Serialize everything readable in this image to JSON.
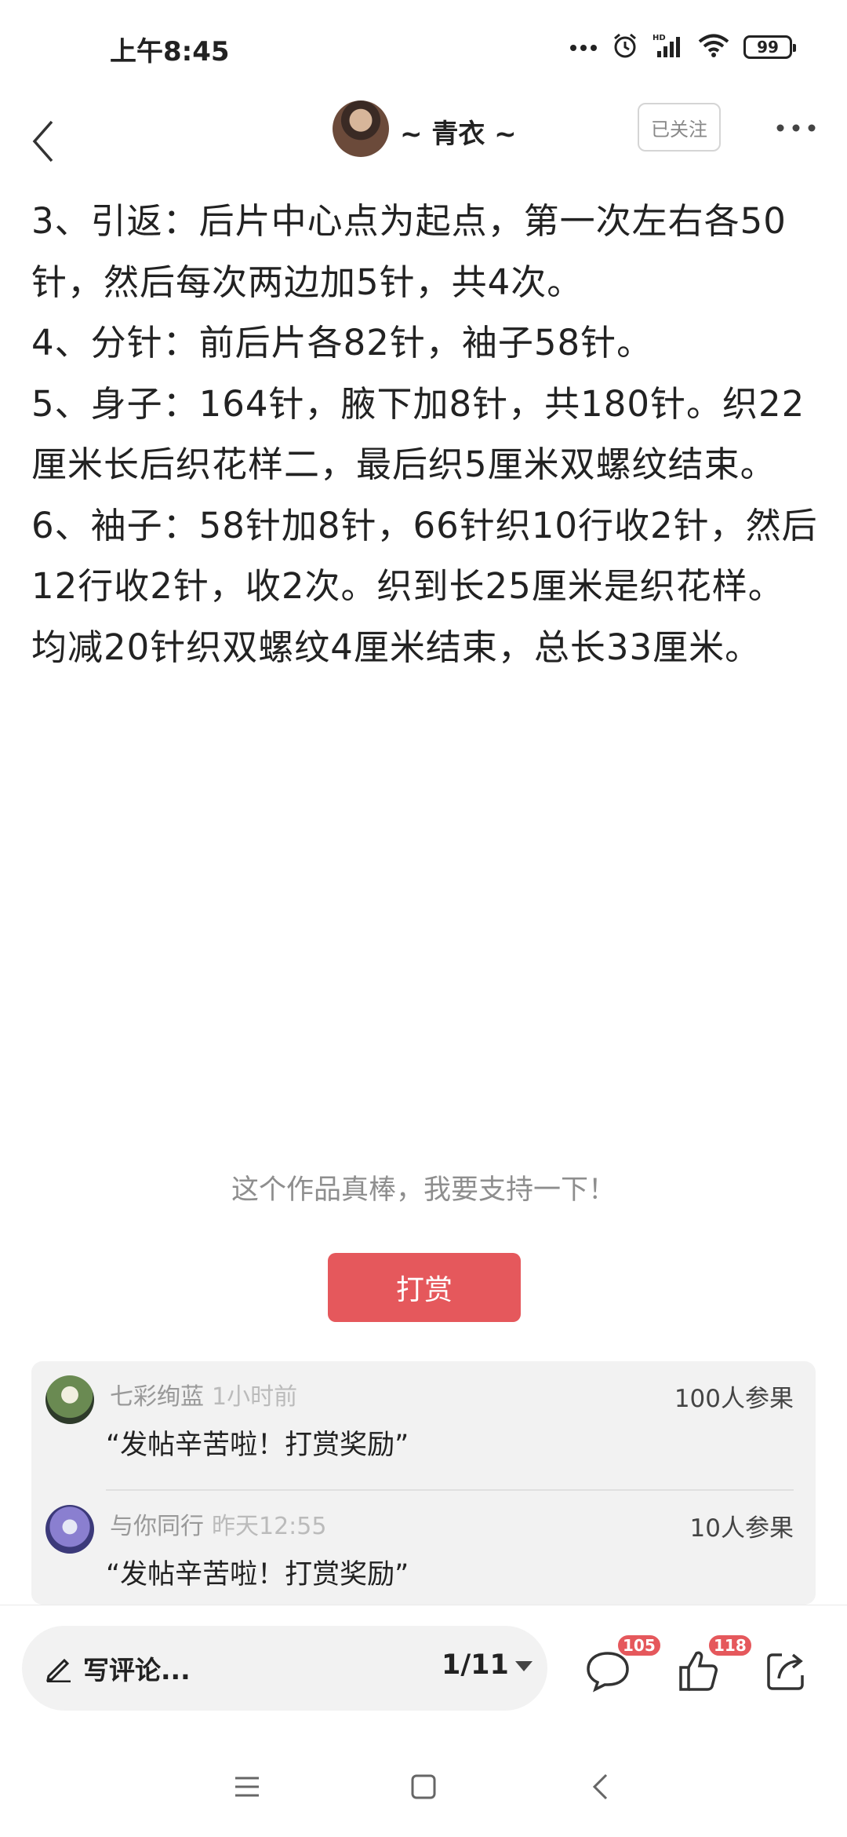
{
  "status_bar": {
    "time": "上午8:45",
    "battery": "99",
    "icons": [
      "more-dots-icon",
      "alarm-icon",
      "hd-signal-icon",
      "wifi-icon",
      "battery-icon"
    ]
  },
  "header": {
    "author_name": "~ 青衣 ~",
    "follow_label": "已关注"
  },
  "article": {
    "paragraphs": [
      "3、引返：后片中心点为起点，第一次左右各50针，然后每次两边加5针，共4次。",
      "4、分针：前后片各82针，袖子58针。",
      "5、身子：164针，腋下加8针，共180针。织22厘米长后织花样二，最后织5厘米双螺纹结束。",
      "6、袖子：58针加8针，66针织10行收2针，然后12行收2针，收2次。织到长25厘米是织花样。均减20针织双螺纹4厘米结束，总长33厘米。"
    ]
  },
  "support": {
    "text": "这个作品真棒，我要支持一下！",
    "reward_button": "打赏"
  },
  "reward_list": [
    {
      "name": "七彩绚蓝",
      "time": "1小时前",
      "message": "“发帖辛苦啦！打赏奖励”",
      "count": "100人参果"
    },
    {
      "name": "与你同行",
      "time": "昨天12:55",
      "message": "“发帖辛苦啦！打赏奖励”",
      "count": "10人参果"
    }
  ],
  "bottom_bar": {
    "comment_placeholder": "写评论...",
    "page_indicator": "1/11",
    "comment_count": "105",
    "like_count": "118"
  },
  "colors": {
    "accent": "#e5585c",
    "muted_text": "#8e8e8e",
    "panel_bg": "#f2f2f2"
  }
}
